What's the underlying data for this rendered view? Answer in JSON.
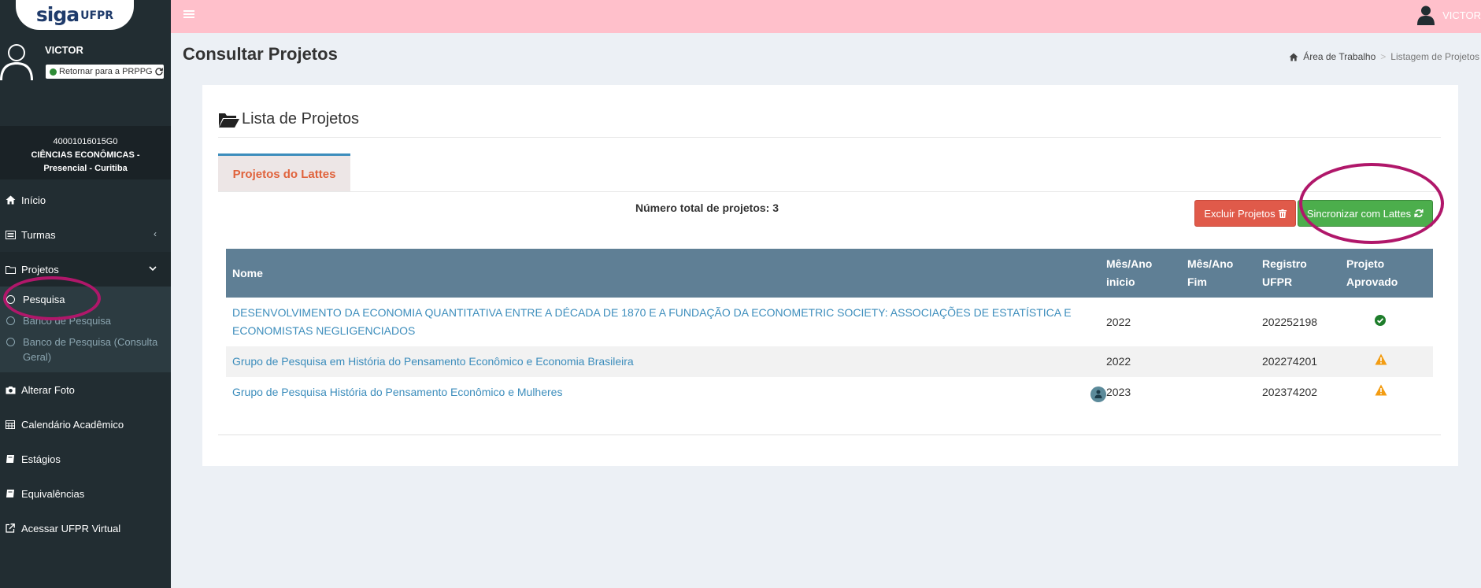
{
  "brand": {
    "logo_main": "siga",
    "logo_sub": "UFPR"
  },
  "user": {
    "name": "VICTOR",
    "return_label": "Retornar para a PRPPG"
  },
  "course": {
    "code": "40001016015G0",
    "name": "CIÊNCIAS ECONÔMICAS -",
    "mode": "Presencial - Curitiba"
  },
  "menu": {
    "inicio": "Início",
    "turmas": "Turmas",
    "projetos": "Projetos",
    "sub": [
      "Pesquisa",
      "Banco de Pesquisa",
      "Banco de Pesquisa (Consulta Geral)"
    ],
    "alterar_foto": "Alterar Foto",
    "calendario": "Calendário Acadêmico",
    "estagios": "Estágios",
    "equivalencias": "Equivalências",
    "acessar": "Acessar UFPR Virtual"
  },
  "topbar": {
    "user": "VICTOR"
  },
  "page": {
    "title": "Consultar Projetos"
  },
  "breadcrumb": {
    "home": "Área de Trabalho",
    "current": "Listagem de Projetos"
  },
  "box": {
    "title": "Lista de Projetos",
    "tab": "Projetos do Lattes",
    "total": "Número total de projetos: 3",
    "btn_delete": "Excluir Projetos",
    "btn_sync": "Sincronizar com Lattes"
  },
  "table": {
    "headers": [
      "Nome",
      "Mês/Ano inicio",
      "Mês/Ano Fim",
      "Registro UFPR",
      "Projeto Aprovado"
    ],
    "rows": [
      {
        "nome": "DESENVOLVIMENTO DA ECONOMIA QUANTITATIVA ENTRE A DÉCADA DE 1870 E A FUNDAÇÃO DA ECONOMETRIC SOCIETY: ASSOCIAÇÕES DE ESTATÍSTICA E ECONOMISTAS NEGLIGENCIADOS",
        "inicio": "2022",
        "fim": "",
        "registro": "202252198",
        "status": "approved"
      },
      {
        "nome": "Grupo de Pesquisa em História do Pensamento Econômico e Economia Brasileira",
        "inicio": "2022",
        "fim": "",
        "registro": "202274201",
        "status": "warning"
      },
      {
        "nome": "Grupo de Pesquisa História do Pensamento Econômico e Mulheres",
        "inicio": "2023",
        "fim": "",
        "registro": "202374202",
        "status": "warning"
      }
    ]
  },
  "colors": {
    "sidebar": "#222d32",
    "topbar": "#ffc0cb",
    "table_header": "#5f7f95",
    "link": "#3c8dbc",
    "danger": "#e05a4a",
    "success": "#4cae4c",
    "annotation": "#b0176a"
  }
}
